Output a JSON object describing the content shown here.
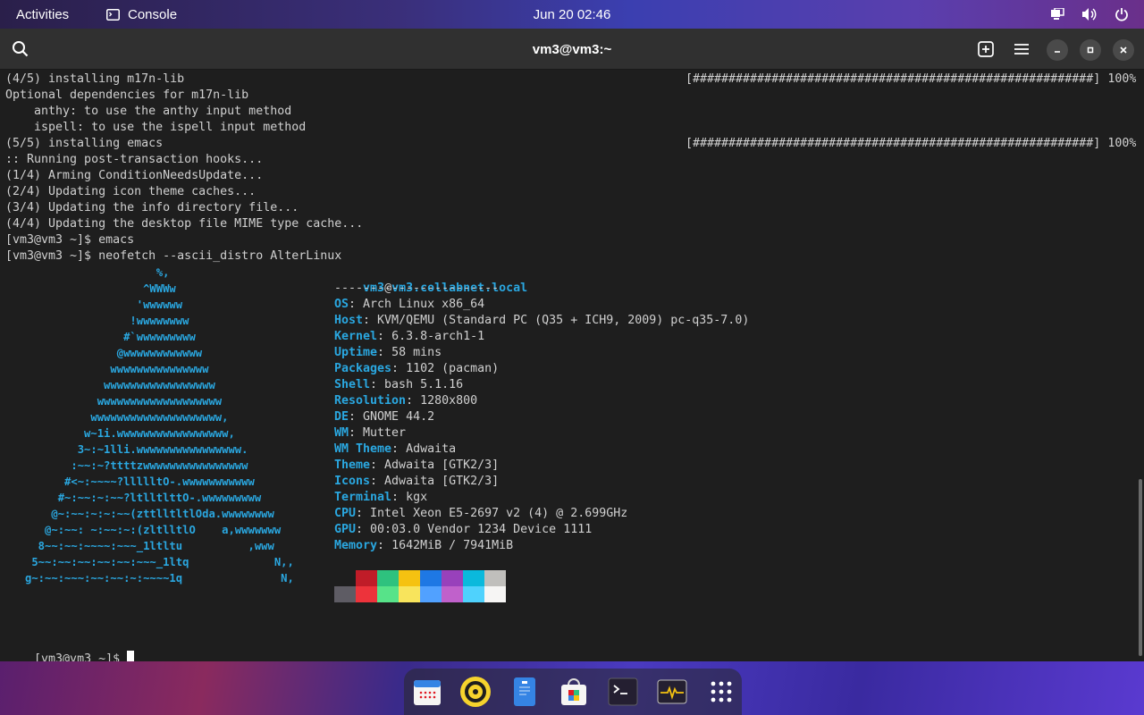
{
  "topbar": {
    "activities": "Activities",
    "app_name": "Console",
    "clock": "Jun 20  02:46"
  },
  "header": {
    "title": "vm3@vm3:~"
  },
  "terminal": {
    "lines_top": [
      "(4/5) installing m17n-lib",
      "Optional dependencies for m17n-lib",
      "    anthy: to use the anthy input method",
      "    ispell: to use the ispell input method",
      "(5/5) installing emacs",
      ":: Running post-transaction hooks...",
      "(1/4) Arming ConditionNeedsUpdate...",
      "(2/4) Updating icon theme caches...",
      "(3/4) Updating the info directory file...",
      "(4/4) Updating the desktop file MIME type cache...",
      "[vm3@vm3 ~]$ emacs",
      "[vm3@vm3 ~]$ neofetch --ascii_distro AlterLinux"
    ],
    "progress_1": "[########################################################] 100%",
    "progress_2": "[########################################################] 100%",
    "ascii_art": [
      "                       %,",
      "                     ^WWWw",
      "                    'wwwwww",
      "                   !wwwwwwww",
      "                  #`wwwwwwwww",
      "                 @wwwwwwwwwwww",
      "                wwwwwwwwwwwwwww",
      "               wwwwwwwwwwwwwwwww",
      "              wwwwwwwwwwwwwwwwwww",
      "             wwwwwwwwwwwwwwwwwwww,",
      "            w~1i.wwwwwwwwwwwwwwwww,",
      "           3~:~1lli.wwwwwwwwwwwwwwww.",
      "          :~~:~?ttttzwwwwwwwwwwwwwwww",
      "         #<~:~~~~?llllltO-.wwwwwwwwwww",
      "        #~:~~:~:~~?ltlltlttO-.wwwwwwwww",
      "       @~:~~:~:~:~~(zttlltltlOda.wwwwwwww",
      "      @~:~~: ~:~~:~:(zltlltlO    a,wwwwwww",
      "     8~~:~~:~~~~:~~~_1ltltu          ,www",
      "    5~~:~~:~~:~~:~~:~~~_1ltq             N,,",
      "   g~:~~:~~~:~~:~~:~:~~~~1q               N,"
    ],
    "neofetch_user": "vm3",
    "neofetch_host": "vm3.collabnet.local",
    "neofetch_sep": "-----------------------",
    "info": [
      {
        "key": "OS",
        "value": "Arch Linux x86_64"
      },
      {
        "key": "Host",
        "value": "KVM/QEMU (Standard PC (Q35 + ICH9, 2009) pc-q35-7.0)"
      },
      {
        "key": "Kernel",
        "value": "6.3.8-arch1-1"
      },
      {
        "key": "Uptime",
        "value": "58 mins"
      },
      {
        "key": "Packages",
        "value": "1102 (pacman)"
      },
      {
        "key": "Shell",
        "value": "bash 5.1.16"
      },
      {
        "key": "Resolution",
        "value": "1280x800"
      },
      {
        "key": "DE",
        "value": "GNOME 44.2"
      },
      {
        "key": "WM",
        "value": "Mutter"
      },
      {
        "key": "WM Theme",
        "value": "Adwaita"
      },
      {
        "key": "Theme",
        "value": "Adwaita [GTK2/3]"
      },
      {
        "key": "Icons",
        "value": "Adwaita [GTK2/3]"
      },
      {
        "key": "Terminal",
        "value": "kgx"
      },
      {
        "key": "CPU",
        "value": "Intel Xeon E5-2697 v2 (4) @ 2.699GHz"
      },
      {
        "key": "GPU",
        "value": "00:03.0 Vendor 1234 Device 1111"
      },
      {
        "key": "Memory",
        "value": "1642MiB / 7941MiB"
      }
    ],
    "palette_top": [
      "#1e1e1e",
      "#c01c28",
      "#2ec27e",
      "#f5c211",
      "#1e78e4",
      "#9841bb",
      "#0ab9dc",
      "#c0bfbc"
    ],
    "palette_bottom": [
      "#5e5c64",
      "#ed333b",
      "#57e389",
      "#f8e45c",
      "#51a1ff",
      "#c061cb",
      "#4fd2fd",
      "#f6f5f4"
    ],
    "prompt": "[vm3@vm3 ~]$ "
  },
  "dock": {
    "items": [
      "calendar-app",
      "rhythmbox-app",
      "text-editor-app",
      "software-app",
      "console-app",
      "system-monitor-app",
      "show-apps"
    ]
  }
}
